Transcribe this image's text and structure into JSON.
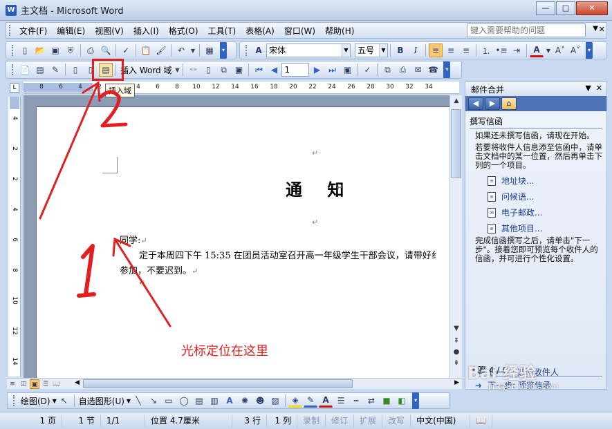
{
  "window": {
    "title": "主文档 - Microsoft Word",
    "minimize_label": "—",
    "maximize_label": "□",
    "close_label": "✕"
  },
  "menu": {
    "items": [
      "文件(F)",
      "编辑(E)",
      "视图(V)",
      "插入(I)",
      "格式(O)",
      "工具(T)",
      "表格(A)",
      "窗口(W)",
      "帮助(H)"
    ],
    "help_placeholder": "键入需要帮助的问题"
  },
  "formatting": {
    "style_value": "宋体",
    "font_size_value": "五号",
    "style_icon": "style-a-icon"
  },
  "mailmerge_toolbar": {
    "insert_word_field_label": "插入 Word 域",
    "record_number": "1",
    "tooltip": "插入域"
  },
  "ruler": {
    "h_ticks": [
      "8",
      "6",
      "4",
      "2",
      "2",
      "4",
      "6",
      "8",
      "10",
      "12",
      "14",
      "16",
      "18",
      "20",
      "22",
      "24",
      "26",
      "28",
      "30",
      "32",
      "34"
    ],
    "v_ticks": [
      "4",
      "2",
      "2",
      "4",
      "6",
      "8",
      "10",
      "12",
      "14"
    ]
  },
  "document": {
    "title": "通  知",
    "salutation": "同学:",
    "body_line1": "定于本周四下午 15:35 在团员活动室召开高一年级学生干部会议，请带好纟",
    "body_line2": "参加，不要迟到。",
    "para_mark": "↵"
  },
  "task_pane": {
    "title": "邮件合并",
    "section_title": "撰写信函",
    "intro_text": "如果还未撰写信函，请现在开始。",
    "instruction_text": "若要将收件人信息添至信函中，请单击文档中的某一位置，然后再单击下列的一个项目。",
    "links": [
      "地址块...",
      "问候语...",
      "电子邮政...",
      "其他项目..."
    ],
    "after_text": "完成信函撰写之后，请单击\"下一步\"。接着您即可预览每个收件人的信函，并可进行个性化设置。",
    "step_label": "步骤 4 / 6",
    "next_label": "下一步: 预览信函",
    "prev_label": "上一步: 选取收件人"
  },
  "drawing": {
    "draw_label": "绘图(D)",
    "autoshapes_label": "自选图形(U)"
  },
  "status": {
    "page": "1 页",
    "section": "1 节",
    "page_of": "1/1",
    "position": "位置 4.7厘米",
    "line": "3 行",
    "column": "1 列",
    "rec": "录制",
    "trk": "修订",
    "ext": "扩展",
    "ovr": "改写",
    "language": "中文(中国)"
  },
  "annotations": {
    "caption": "光标定位在这里",
    "marker_1": "1",
    "marker_2": "2",
    "accent_color": "#e02020"
  },
  "watermark": {
    "brand": "Bai 经验",
    "url": "jingyan.baidu.com"
  }
}
